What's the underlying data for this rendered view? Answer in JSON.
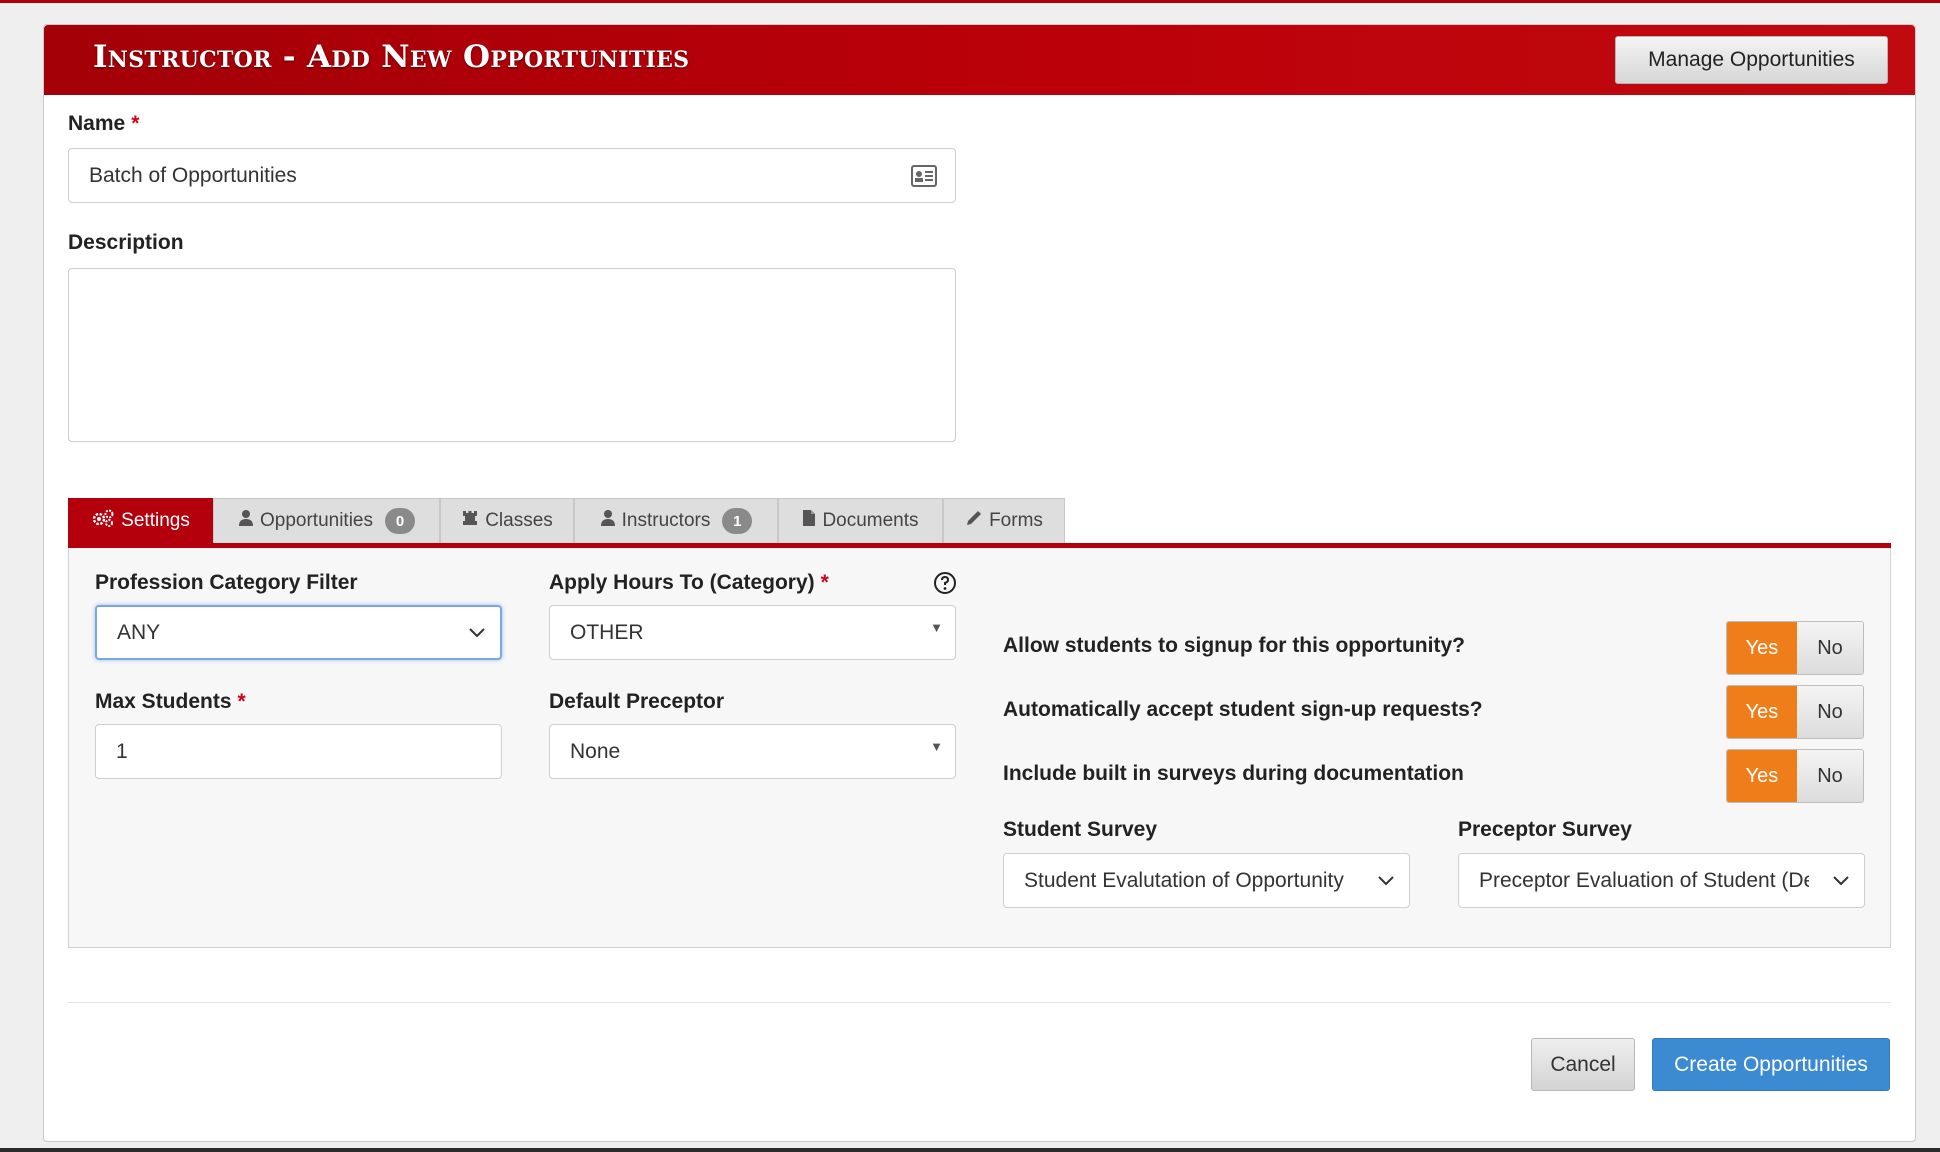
{
  "header": {
    "title": "Instructor - Add New Opportunities",
    "manage_button": "Manage Opportunities"
  },
  "form": {
    "name_label": "Name",
    "required_mark": "*",
    "name_value": "Batch of Opportunities",
    "description_label": "Description",
    "description_value": ""
  },
  "tabs": [
    {
      "label": "Settings",
      "icon": "gears-icon",
      "active": true
    },
    {
      "label": "Opportunities",
      "icon": "user-icon",
      "badge": "0"
    },
    {
      "label": "Classes",
      "icon": "chess-rook-icon"
    },
    {
      "label": "Instructors",
      "icon": "user-icon",
      "badge": "1"
    },
    {
      "label": "Documents",
      "icon": "file-icon"
    },
    {
      "label": "Forms",
      "icon": "pencil-icon"
    }
  ],
  "settings": {
    "profession_filter_label": "Profession Category Filter",
    "profession_filter_value": "ANY",
    "apply_hours_label": "Apply Hours To (Category)",
    "apply_hours_value": "OTHER",
    "max_students_label": "Max Students",
    "max_students_value": "1",
    "default_preceptor_label": "Default Preceptor",
    "default_preceptor_value": "None",
    "questions": [
      {
        "text": "Allow students to signup for this opportunity?",
        "yes": "Yes",
        "no": "No",
        "selected": "Yes"
      },
      {
        "text": "Automatically accept student sign-up requests?",
        "yes": "Yes",
        "no": "No",
        "selected": "Yes"
      },
      {
        "text": "Include built in surveys during documentation",
        "yes": "Yes",
        "no": "No",
        "selected": "Yes"
      }
    ],
    "student_survey_label": "Student Survey",
    "student_survey_value": "Student Evalutation of Opportunity",
    "preceptor_survey_label": "Preceptor Survey",
    "preceptor_survey_value": "Preceptor Evaluation of Student (De"
  },
  "footer": {
    "cancel": "Cancel",
    "create": "Create Opportunities"
  },
  "colors": {
    "brand_red": "#b3000c",
    "toggle_orange": "#ef7d1a",
    "primary_blue": "#3c8ad1"
  }
}
